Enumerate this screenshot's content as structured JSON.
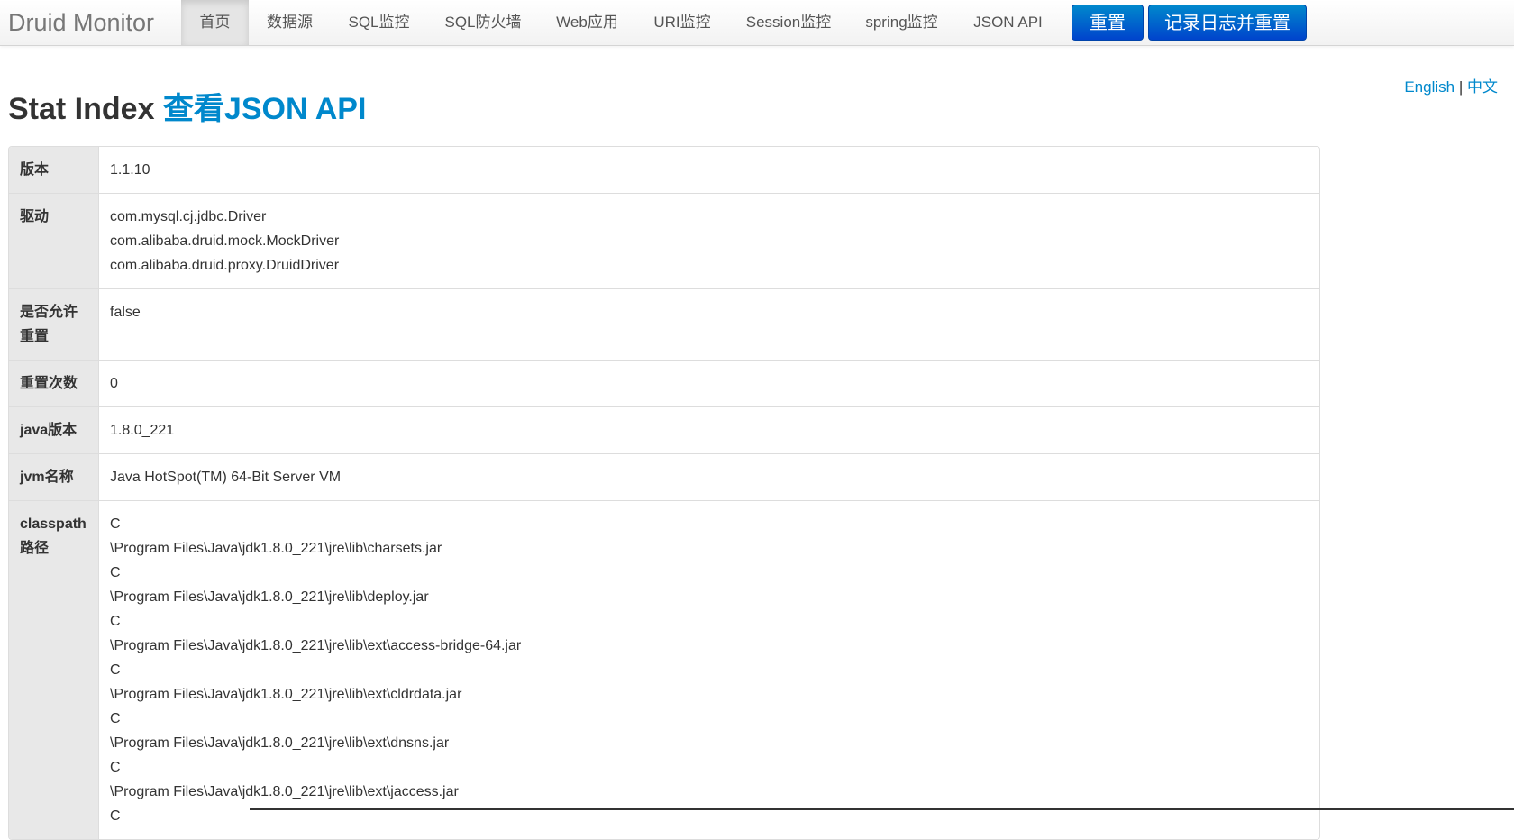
{
  "navbar": {
    "brand": "Druid Monitor",
    "items": [
      {
        "label": "首页",
        "active": true
      },
      {
        "label": "数据源"
      },
      {
        "label": "SQL监控"
      },
      {
        "label": "SQL防火墙"
      },
      {
        "label": "Web应用"
      },
      {
        "label": "URI监控"
      },
      {
        "label": "Session监控"
      },
      {
        "label": "spring监控"
      },
      {
        "label": "JSON API"
      }
    ],
    "reset_label": "重置",
    "log_reset_label": "记录日志并重置"
  },
  "lang": {
    "english": "English",
    "separator": "|",
    "chinese": "中文"
  },
  "title": {
    "text": "Stat Index",
    "link": "查看JSON API"
  },
  "rows": [
    {
      "label": "版本",
      "values": [
        "1.1.10"
      ]
    },
    {
      "label": "驱动",
      "values": [
        "com.mysql.cj.jdbc.Driver",
        "com.alibaba.druid.mock.MockDriver",
        "com.alibaba.druid.proxy.DruidDriver"
      ]
    },
    {
      "label": "是否允许重置",
      "values": [
        "false"
      ]
    },
    {
      "label": "重置次数",
      "values": [
        "0"
      ]
    },
    {
      "label": "java版本",
      "values": [
        "1.8.0_221"
      ]
    },
    {
      "label": "jvm名称",
      "values": [
        "Java HotSpot(TM) 64-Bit Server VM"
      ]
    },
    {
      "label": "classpath路径",
      "values": [
        "C",
        "\\Program Files\\Java\\jdk1.8.0_221\\jre\\lib\\charsets.jar",
        "C",
        "\\Program Files\\Java\\jdk1.8.0_221\\jre\\lib\\deploy.jar",
        "C",
        "\\Program Files\\Java\\jdk1.8.0_221\\jre\\lib\\ext\\access-bridge-64.jar",
        "C",
        "\\Program Files\\Java\\jdk1.8.0_221\\jre\\lib\\ext\\cldrdata.jar",
        "C",
        "\\Program Files\\Java\\jdk1.8.0_221\\jre\\lib\\ext\\dnsns.jar",
        "C",
        "\\Program Files\\Java\\jdk1.8.0_221\\jre\\lib\\ext\\jaccess.jar",
        "C"
      ]
    }
  ]
}
